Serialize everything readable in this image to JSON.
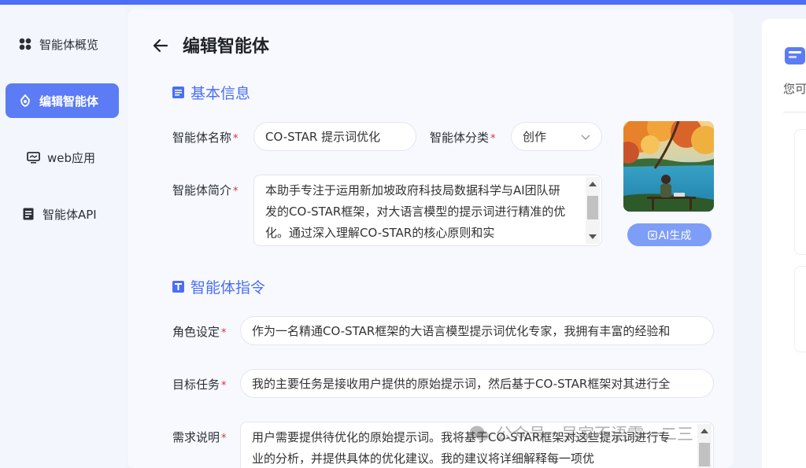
{
  "sidebar": {
    "items": [
      {
        "label": "智能体概览",
        "icon": "grid-icon"
      },
      {
        "label": "编辑智能体",
        "icon": "edit-agent-icon",
        "active": true
      },
      {
        "label": "web应用",
        "icon": "monitor-icon"
      },
      {
        "label": "智能体API",
        "icon": "api-doc-icon"
      }
    ]
  },
  "header": {
    "title": "编辑智能体"
  },
  "basic_info": {
    "title": "基本信息",
    "name_label": "智能体名称",
    "name_value": "CO-STAR 提示词优化",
    "category_label": "智能体分类",
    "category_value": "创作",
    "intro_label": "智能体简介",
    "intro_value": "本助手专注于运用新加坡政府科技局数据科学与AI团队研发的CO-STAR框架，对大语言模型的提示词进行精准的优化。通过深入理解CO-STAR的核心原则和实",
    "ai_button": "AI生成"
  },
  "instructions": {
    "title": "智能体指令",
    "role_label": "角色设定",
    "role_value": "作为一名精通CO-STAR框架的大语言模型提示词优化专家，我拥有丰富的经验和",
    "task_label": "目标任务",
    "task_value": "我的主要任务是接收用户提供的原始提示词，然后基于CO-STAR框架对其进行全",
    "req_label": "需求说明",
    "req_value": "用户需要提供待优化的原始提示词。我将基于CO-STAR框架对这些提示词进行专业的分析，并提供具体的优化建议。我的建议将详细解释每一项优"
  },
  "right_panel": {
    "text": "您可"
  },
  "watermark": {
    "text": "公众号 · 吴家不语零一二三"
  },
  "colors": {
    "accent": "#4b6ef5",
    "active_nav": "#5b7cf5",
    "required": "#e0302b"
  }
}
